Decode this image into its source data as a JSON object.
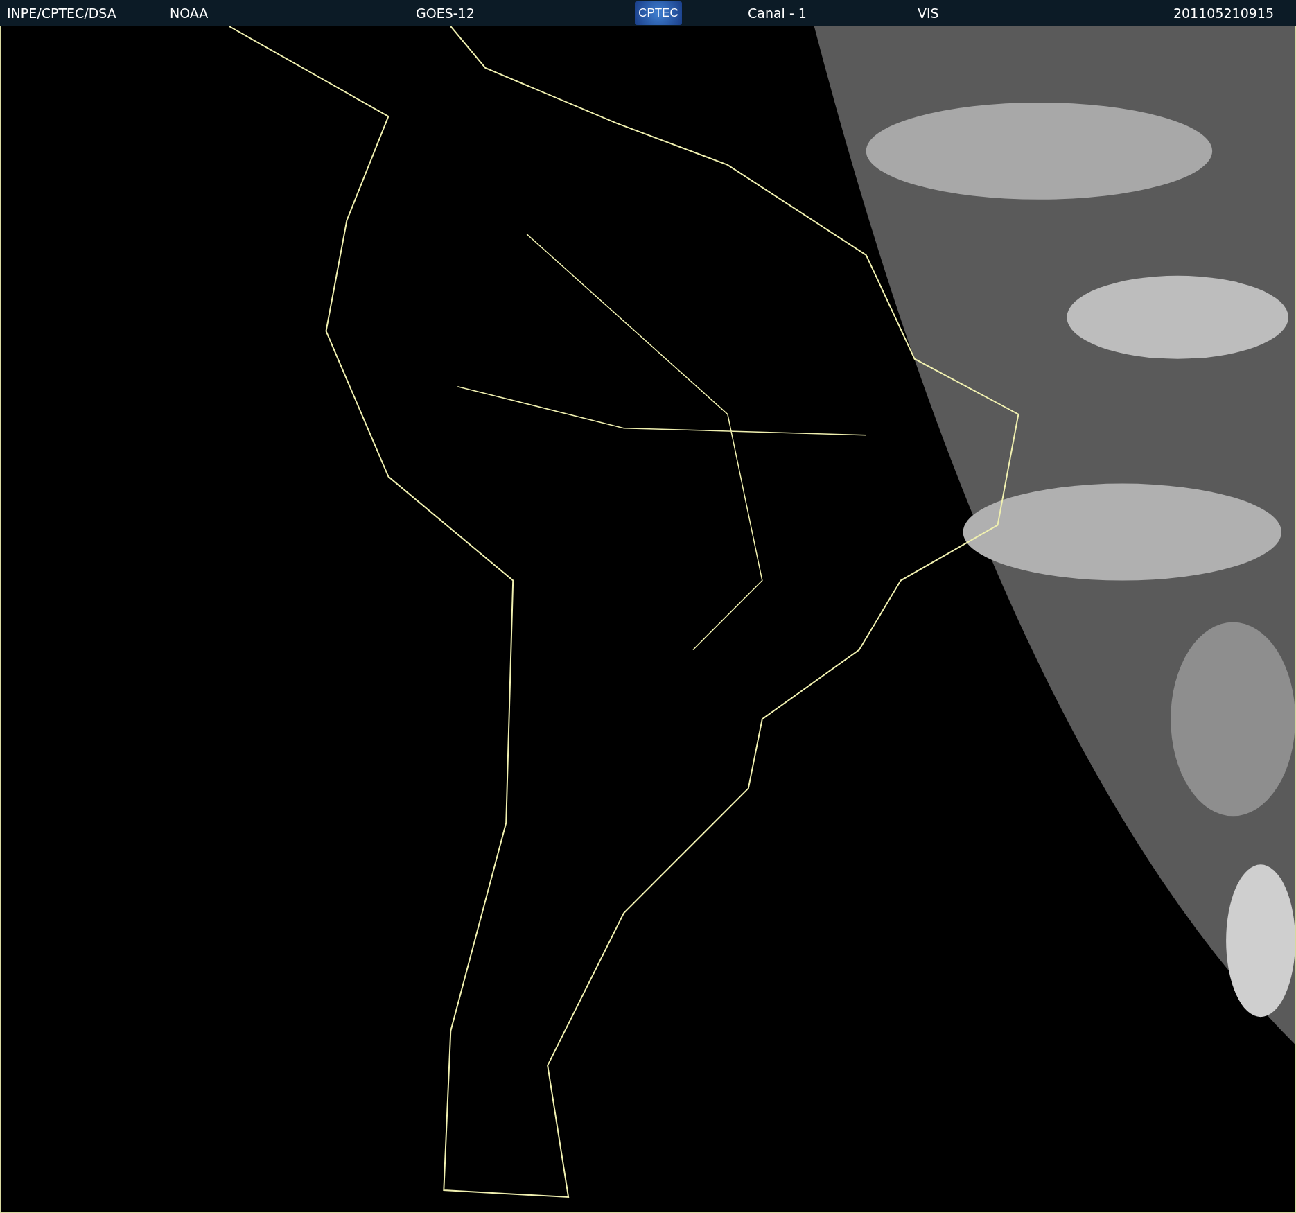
{
  "header": {
    "source": "INPE/CPTEC/DSA",
    "agency": "NOAA",
    "satellite": "GOES-12",
    "logo": "CPTEC",
    "channel": "Canal - 1",
    "band": "VIS",
    "timestamp": "201105210915"
  }
}
